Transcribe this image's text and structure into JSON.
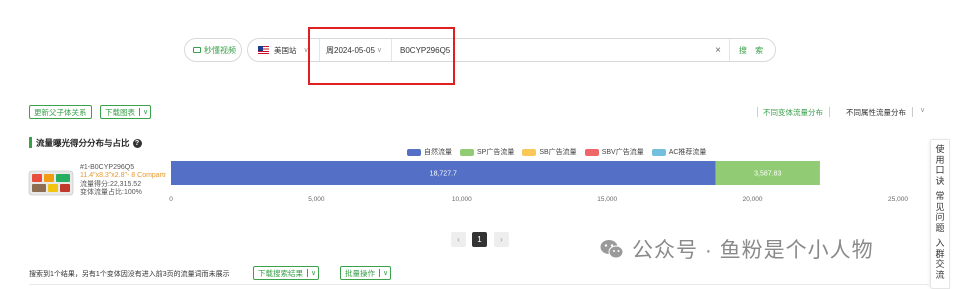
{
  "search": {
    "video_label": "秒懂视频",
    "site": "美国站",
    "week": "周2024-05-05",
    "asin": "B0CYP296Q5",
    "clear": "×",
    "search_label": "搜 索"
  },
  "toolbar": {
    "update_relation": "更新父子体关系",
    "download_chart": "下载图表",
    "variant_dist": "不同变体流量分布",
    "attr_dist": "不同属性流量分布"
  },
  "chart_section": {
    "title": "流量曝光得分分布与占比",
    "help": "?"
  },
  "product": {
    "asin_line": "#1-B0CYP296Q5",
    "desc_line": "11.4\"x8.3\"x2.8\"- 8 Compartm",
    "score_line": "流量得分:22,315.52",
    "share_line": "变体流量占比:100%"
  },
  "chart_data": {
    "type": "bar",
    "orientation": "horizontal",
    "stacked": true,
    "categories": [
      "#1-B0CYP296Q5"
    ],
    "series": [
      {
        "name": "自然流量",
        "color": "#5470c6",
        "values": [
          18727.7
        ],
        "label": "18,727.7"
      },
      {
        "name": "SP广告流量",
        "color": "#91cc75",
        "values": [
          3587.83
        ],
        "label": "3,587.83"
      },
      {
        "name": "SB广告流量",
        "color": "#fac858",
        "values": [
          0
        ]
      },
      {
        "name": "SBV广告流量",
        "color": "#ee6666",
        "values": [
          0
        ]
      },
      {
        "name": "AC推荐流量",
        "color": "#73c0de",
        "values": [
          0
        ]
      }
    ],
    "xlim": [
      0,
      25000
    ],
    "ticks": [
      0,
      5000,
      10000,
      15000,
      20000,
      25000
    ],
    "tick_labels": [
      "0",
      "5,000",
      "10,000",
      "15,000",
      "20,000",
      "25,000"
    ],
    "grid": false,
    "legend_position": "top"
  },
  "pagination": {
    "prev": "‹",
    "current": "1",
    "next": "›"
  },
  "side_panel": {
    "chars": [
      "使",
      "用",
      "口",
      "诀",
      "",
      "常",
      "见",
      "问",
      "题",
      "",
      "入",
      "群",
      "交",
      "流"
    ]
  },
  "watermark": {
    "text": "公众号 · 鱼粉是个小人物"
  },
  "results": {
    "summary": "搜索到1个结果，另有1个变体因没有进入前3页的流量词而未展示",
    "download_keywords": "下载搜索结果",
    "batch_ops": "批量操作"
  },
  "colors": {
    "accent": "#3aa14a",
    "highlight_box": "#e02020"
  }
}
